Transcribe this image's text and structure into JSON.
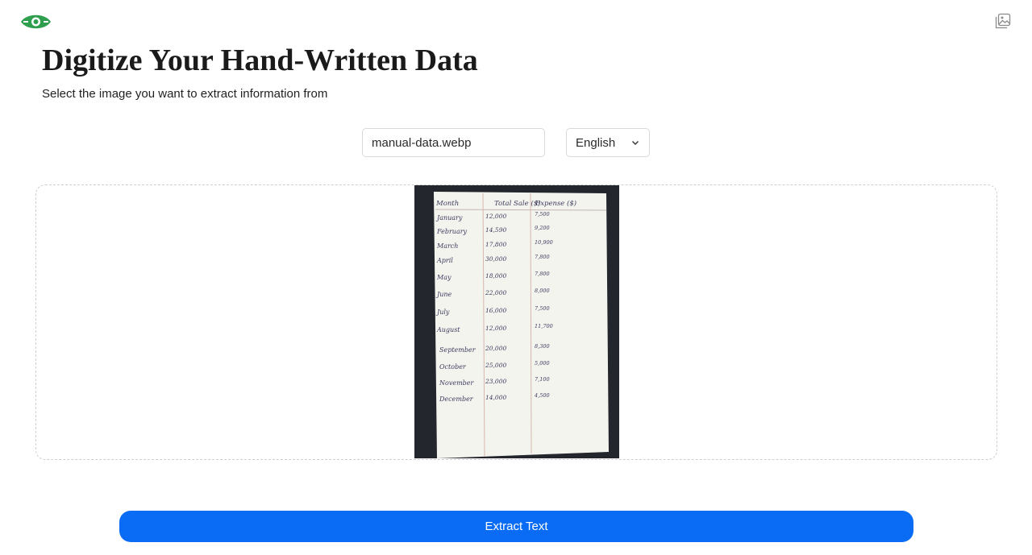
{
  "header": {
    "logo_icon": "eye-leaf-logo",
    "gallery_icon": "image-gallery-icon",
    "title": "Digitize Your Hand-Written Data",
    "subtitle": "Select the image you want to extract information from"
  },
  "controls": {
    "file_name": "manual-data.webp",
    "language": "English",
    "language_icon": "chevron-down-icon"
  },
  "preview": {
    "table_headers": [
      "Month",
      "Total Sale ($)",
      "Expense ($)"
    ],
    "rows": [
      {
        "month": "January",
        "sale": "12,000",
        "expense": "7,500"
      },
      {
        "month": "February",
        "sale": "14,590",
        "expense": "9,200"
      },
      {
        "month": "March",
        "sale": "17,800",
        "expense": "10,900"
      },
      {
        "month": "April",
        "sale": "30,000",
        "expense": "7,800"
      },
      {
        "month": "May",
        "sale": "18,000",
        "expense": "7,800"
      },
      {
        "month": "June",
        "sale": "22,000",
        "expense": "8,000"
      },
      {
        "month": "July",
        "sale": "16,000",
        "expense": "7,500"
      },
      {
        "month": "August",
        "sale": "12,000",
        "expense": "11,700"
      },
      {
        "month": "September",
        "sale": "20,000",
        "expense": "8,300"
      },
      {
        "month": "October",
        "sale": "25,000",
        "expense": "5,000"
      },
      {
        "month": "November",
        "sale": "23,000",
        "expense": "7,100"
      },
      {
        "month": "December",
        "sale": "14,000",
        "expense": "4,500"
      }
    ]
  },
  "actions": {
    "extract_label": "Extract Text"
  },
  "colors": {
    "accent": "#0a6cf5",
    "logo_green": "#2e9e4f",
    "photo_background": "#23262d",
    "paper": "#f4f4ef"
  }
}
